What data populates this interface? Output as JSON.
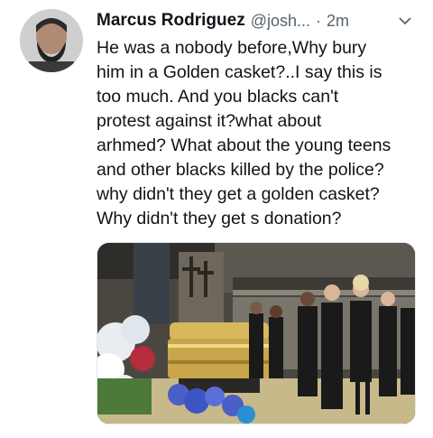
{
  "tweet": {
    "author": {
      "display_name": "Marcus Rodriguez",
      "handle": "@josh...",
      "avatar_icon": "avatar-photo"
    },
    "separator": "·",
    "timestamp": "2m",
    "menu_icon": "chevron-down-icon",
    "text": "He was a nobody before,Why bury\nhim in a Golden casket?..I say this is\ntoo much. And you blacks can't\nprotest against it?what about\narhmed? What about the young teens\nand other blacks killed by the police?\nwhy didn't they get a golden casket?\nWhy didn't they get s donation?",
    "media": {
      "type": "photo",
      "icon": "funeral-photo"
    }
  },
  "colors": {
    "text_primary": "#0f1419",
    "text_secondary": "#536471",
    "casket_gold": "#c9a64a"
  }
}
